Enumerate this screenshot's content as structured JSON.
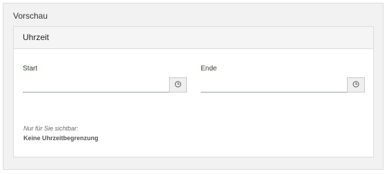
{
  "preview": {
    "title": "Vorschau",
    "panel": {
      "header": "Uhrzeit",
      "start": {
        "label": "Start",
        "value": "",
        "icon": "clock-icon"
      },
      "end": {
        "label": "Ende",
        "value": "",
        "icon": "clock-icon"
      },
      "note_italic": "Nur für Sie sichtbar:",
      "note_bold": "Keine Uhrzeitbegrenzung"
    }
  }
}
